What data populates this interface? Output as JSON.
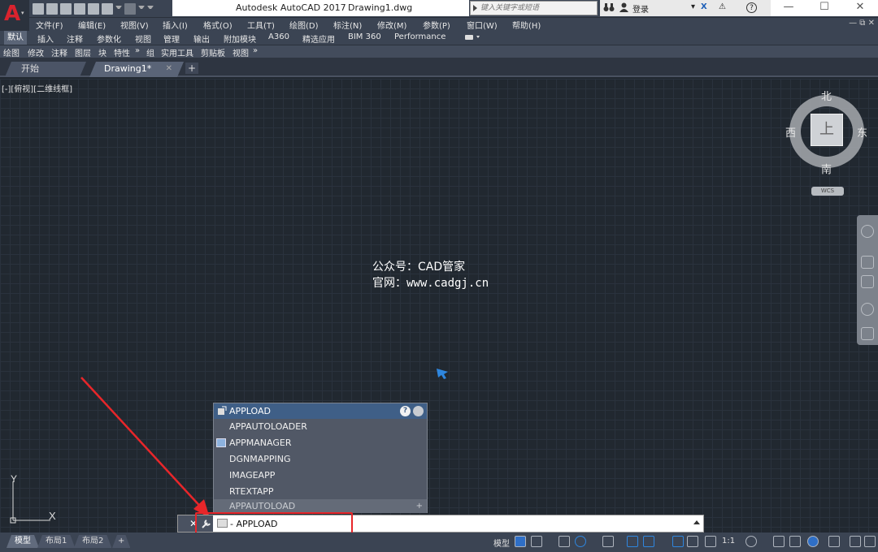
{
  "window": {
    "app_title": "Autodesk AutoCAD 2017",
    "file_title": "Drawing1.dwg",
    "search_placeholder": "键入关键字或短语",
    "login_label": "登录"
  },
  "menu": [
    "文件(F)",
    "编辑(E)",
    "视图(V)",
    "插入(I)",
    "格式(O)",
    "工具(T)",
    "绘图(D)",
    "标注(N)",
    "修改(M)",
    "参数(P)",
    "窗口(W)",
    "帮助(H)"
  ],
  "ribbon_tabs": [
    "默认",
    "插入",
    "注释",
    "参数化",
    "视图",
    "管理",
    "输出",
    "附加模块",
    "A360",
    "精选应用",
    "BIM 360",
    "Performance"
  ],
  "panels": [
    "绘图",
    "修改",
    "注释",
    "图层",
    "块",
    "特性",
    "组",
    "实用工具",
    "剪贴板",
    "视图"
  ],
  "file_tabs": {
    "start": "开始",
    "active": "Drawing1*",
    "add": "+"
  },
  "viewport_label": "[-][俯视][二维线框]",
  "viewcube": {
    "north": "北",
    "south": "南",
    "east": "东",
    "west": "西",
    "face": "上",
    "wcs": "WCS"
  },
  "watermark": {
    "line1": "公众号：CAD管家",
    "line2": "官网：www.cadgj.cn"
  },
  "ucs": {
    "x_label": "X",
    "y_label": "Y"
  },
  "autocomplete": {
    "header": "APPLOAD",
    "items": [
      "APPAUTOLOADER",
      "APPMANAGER",
      "DGNMAPPING",
      "IMAGEAPP",
      "RTEXTAPP"
    ],
    "footer": "APPAUTOLOAD"
  },
  "command": {
    "value": "- APPLOAD"
  },
  "layouts": [
    "模型",
    "布局1",
    "布局2",
    "+"
  ],
  "status": {
    "model_label": "模型",
    "scale": "1:1"
  },
  "colors": {
    "canvas_bg": "#212830",
    "chrome": "#3b4453",
    "highlight_red": "#e8262a",
    "autocomplete_header": "#3f5f87"
  }
}
